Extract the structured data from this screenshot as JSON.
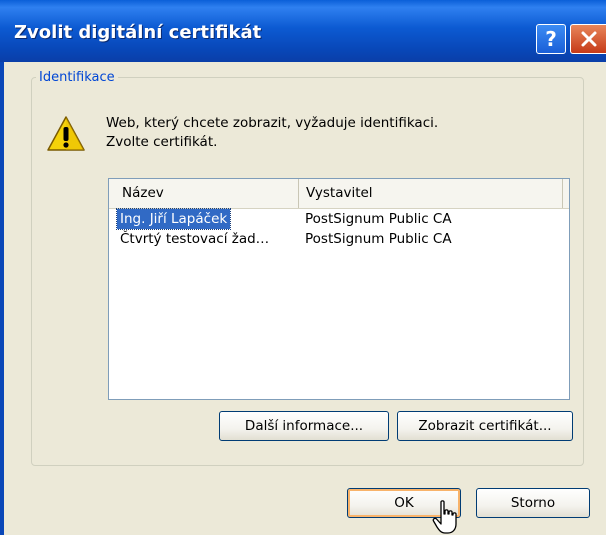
{
  "window": {
    "title": "Zvolit digitální certifikát",
    "help_icon": "question-mark-icon",
    "close_icon": "close-x-icon"
  },
  "group": {
    "legend": "Identifikace",
    "icon": "warning-icon",
    "message_line1": "Web, který chcete zobrazit, vyžaduje identifikaci.",
    "message_line2": "Zvolte certifikát."
  },
  "list": {
    "columns": [
      "Název",
      "Vystavitel"
    ],
    "rows": [
      {
        "name": "Ing. Jiří Lapáček",
        "issuer": "PostSignum Public CA",
        "selected": true
      },
      {
        "name": "Čtvrtý testovací žad…",
        "issuer": "PostSignum Public CA",
        "selected": false
      }
    ]
  },
  "buttons": {
    "more_info": "Další informace...",
    "view_certificate": "Zobrazit certifikát...",
    "ok": "OK",
    "cancel": "Storno"
  },
  "colors": {
    "titlebar": "#0a47b8",
    "legend": "#0046d5",
    "selection": "#316ac5",
    "default_button_focus": "#f8b36a",
    "dialog_background": "#ece9d8"
  }
}
